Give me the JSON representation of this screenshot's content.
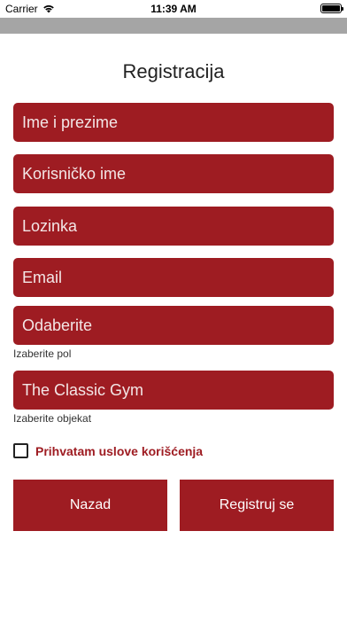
{
  "status_bar": {
    "carrier": "Carrier",
    "time": "11:39 AM"
  },
  "page": {
    "title": "Registracija"
  },
  "form": {
    "full_name_placeholder": "Ime i prezime",
    "username_placeholder": "Korisničko ime",
    "password_placeholder": "Lozinka",
    "email_placeholder": "Email",
    "gender_value": "Odaberite",
    "gender_hint": "Izaberite pol",
    "gym_value": "The Classic Gym",
    "gym_hint": "Izaberite objekat",
    "terms_label": "Prihvatam uslove korišćenja",
    "terms_checked": false
  },
  "buttons": {
    "back_label": "Nazad",
    "register_label": "Registruj se"
  },
  "colors": {
    "accent": "#9e1c22",
    "nav_bar": "#a5a5a5"
  }
}
